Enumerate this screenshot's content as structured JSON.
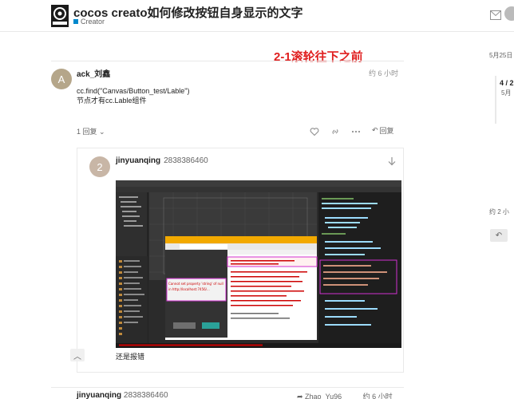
{
  "header": {
    "title": "cocos creato如何修改按钮自身显示的文字",
    "category": "Creator",
    "category_color": "#0088cc"
  },
  "overlay": {
    "label": "2-1滚轮往下之前",
    "color": "#e02020"
  },
  "post1": {
    "avatar_letter": "A",
    "avatar_color": "#b5a68a",
    "username": "ack_刘鑫",
    "time": "约 6 小时",
    "lines": [
      "cc.find(\"Canvas/Button_test/Lable\")",
      "节点才有cc.Lable组件"
    ],
    "replies": "1 回复",
    "reply_label": "回复"
  },
  "embed": {
    "avatar_letter": "2",
    "avatar_color": "#c8b6a6",
    "username": "jinyuanqing",
    "user_id": "2838386460",
    "caption": "还是报错",
    "screenshot_texts": {
      "error_message": "Cannot set property 'string' of null in http://localhost:7456/app/editor/static/preview-templates/node_modules/...",
      "devtools_error": "Uncaught TypeError: Cannot set property 'string' of null",
      "browser_title": "Cocos Creator - NewProject_1",
      "browser_url": "localhost:7456",
      "button_label": "输入文字",
      "button_label2": "按钮文本"
    }
  },
  "timeline": {
    "top_date": "5月25日",
    "progress": "4 / 2",
    "sub_date": "5月",
    "bottom_note": "约 2 小"
  },
  "bottom_post": {
    "username": "jinyuanqing",
    "user_id": "2838386460",
    "right_text": "Zhao_Yu96",
    "time": "约 6 小时"
  }
}
